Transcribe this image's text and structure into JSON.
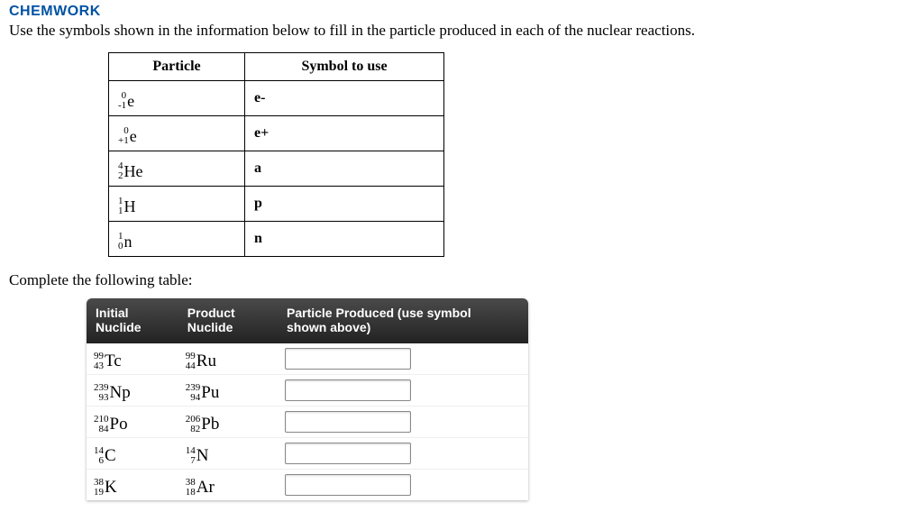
{
  "brand": "CHEMWORK",
  "instruction": "Use the symbols shown in the information below to fill in the particle produced in each of the nuclear reactions.",
  "symtable": {
    "headers": {
      "particle": "Particle",
      "symbol": "Symbol to use"
    },
    "rows": [
      {
        "mass": "0",
        "z": "-1",
        "el": "e",
        "symbol": "e-"
      },
      {
        "mass": "0",
        "z": "+1",
        "el": "e",
        "symbol": "e+"
      },
      {
        "mass": "4",
        "z": "2",
        "el": "He",
        "symbol": "a"
      },
      {
        "mass": "1",
        "z": "1",
        "el": "H",
        "symbol": "p"
      },
      {
        "mass": "1",
        "z": "0",
        "el": "n",
        "symbol": "n"
      }
    ]
  },
  "complete_label": "Complete the following table:",
  "anstable": {
    "headers": {
      "initial": "Initial Nuclide",
      "product": "Product Nuclide",
      "answer": "Particle Produced (use symbol shown above)"
    },
    "rows": [
      {
        "i_mass": "99",
        "i_z": "43",
        "i_el": "Tc",
        "p_mass": "99",
        "p_z": "44",
        "p_el": "Ru",
        "value": ""
      },
      {
        "i_mass": "239",
        "i_z": "93",
        "i_el": "Np",
        "p_mass": "239",
        "p_z": "94",
        "p_el": "Pu",
        "value": ""
      },
      {
        "i_mass": "210",
        "i_z": "84",
        "i_el": "Po",
        "p_mass": "206",
        "p_z": "82",
        "p_el": "Pb",
        "value": ""
      },
      {
        "i_mass": "14",
        "i_z": "6",
        "i_el": "C",
        "p_mass": "14",
        "p_z": "7",
        "p_el": "N",
        "value": ""
      },
      {
        "i_mass": "38",
        "i_z": "19",
        "i_el": "K",
        "p_mass": "38",
        "p_z": "18",
        "p_el": "Ar",
        "value": ""
      }
    ]
  }
}
